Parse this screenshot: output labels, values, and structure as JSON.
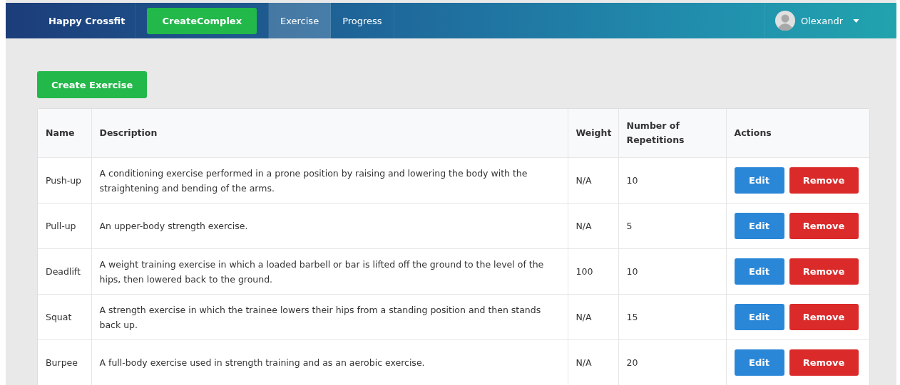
{
  "navbar": {
    "brand": "Happy Crossfit",
    "create_button": "CreateComplex",
    "tabs": [
      {
        "label": "Exercise",
        "selected": true
      },
      {
        "label": "Progress",
        "selected": false
      }
    ],
    "user": {
      "name": "Olexandr"
    }
  },
  "create_button": "Create Exercise",
  "table": {
    "columns": [
      "Name",
      "Description",
      "Weight",
      "Number of Repetitions",
      "Actions"
    ],
    "rows": [
      {
        "name": "Push-up",
        "description": "A conditioning exercise performed in a prone position by raising and lowering the body with the straightening and bending of the arms.",
        "weight": "N/A",
        "repetitions": "10",
        "actions": [
          "Edit",
          "Remove"
        ]
      },
      {
        "name": "Pull-up",
        "description": "An upper-body strength exercise.",
        "weight": "N/A",
        "repetitions": "5",
        "actions": [
          "Edit",
          "Remove"
        ]
      },
      {
        "name": "Deadlift",
        "description": "A weight training exercise in which a loaded barbell or bar is lifted off the ground to the level of the hips, then lowered back to the ground.",
        "weight": "100",
        "repetitions": "10",
        "actions": [
          "Edit",
          "Remove"
        ]
      },
      {
        "name": "Squat",
        "description": "A strength exercise in which the trainee lowers their hips from a standing position and then stands back up.",
        "weight": "N/A",
        "repetitions": "15",
        "actions": [
          "Edit",
          "Remove"
        ]
      },
      {
        "name": "Burpee",
        "description": "A full-body exercise used in strength training and as an aerobic exercise.",
        "weight": "N/A",
        "repetitions": "20",
        "actions": [
          "Edit",
          "Remove"
        ]
      }
    ]
  }
}
